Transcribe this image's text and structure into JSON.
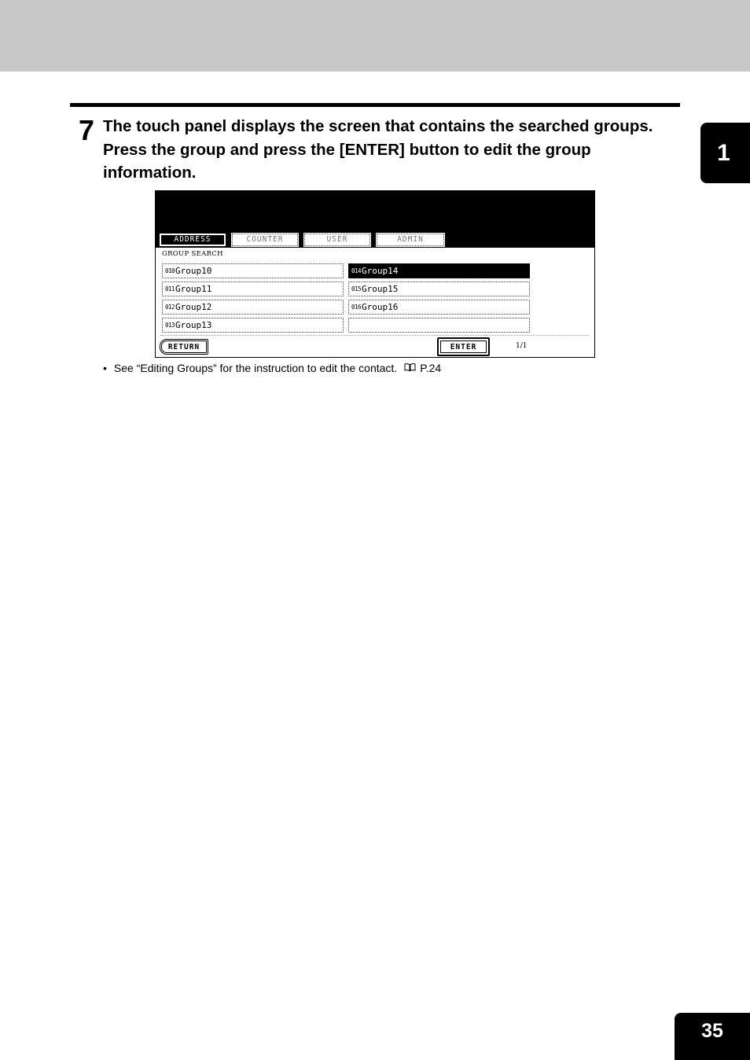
{
  "chapter_tab": "1",
  "step": {
    "number": "7",
    "text": "The touch panel displays the screen that contains the searched groups.  Press the group and press the [ENTER] button to edit the group information."
  },
  "panel": {
    "tabs": [
      {
        "label": "ADDRESS",
        "active": true
      },
      {
        "label": "COUNTER",
        "active": false
      },
      {
        "label": "USER",
        "active": false
      },
      {
        "label": "ADMIN",
        "active": false
      }
    ],
    "search_label": "GROUP SEARCH",
    "groups": [
      {
        "number": "010",
        "name": "Group10",
        "selected": false
      },
      {
        "number": "011",
        "name": "Group11",
        "selected": false
      },
      {
        "number": "012",
        "name": "Group12",
        "selected": false
      },
      {
        "number": "013",
        "name": "Group13",
        "selected": false
      },
      {
        "number": "014",
        "name": "Group14",
        "selected": true
      },
      {
        "number": "015",
        "name": "Group15",
        "selected": false
      },
      {
        "number": "016",
        "name": "Group16",
        "selected": false
      },
      {
        "number": "",
        "name": "",
        "selected": false
      }
    ],
    "return_label": "RETURN",
    "enter_label": "ENTER",
    "page_indicator": "1/1"
  },
  "note": {
    "bullet": "•",
    "text": "See “Editing Groups” for the instruction to edit the contact.",
    "icon": "book-icon",
    "ref": "P.24"
  },
  "page_number": "35"
}
